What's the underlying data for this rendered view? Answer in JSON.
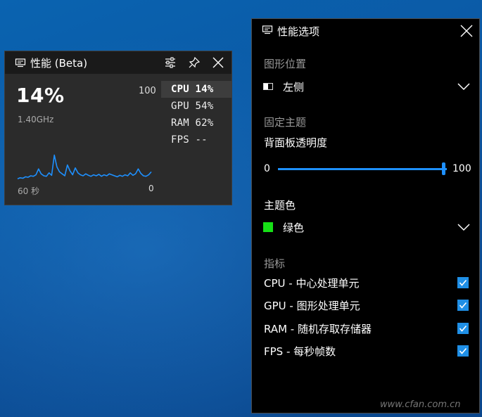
{
  "colors": {
    "accent": "#1e90ff",
    "chart_line": "#1e90ff",
    "theme_swatch": "#16e016"
  },
  "perf_widget": {
    "title": "性能 (Beta)",
    "icons": [
      "monitor-icon",
      "settings-sliders-icon",
      "pin-icon",
      "close-icon"
    ],
    "big_value": "14%",
    "max_label": "100",
    "frequency": "1.40GHz",
    "axis_left": "60 秒",
    "axis_right": "0",
    "metrics": [
      {
        "label": "CPU  14%",
        "active": true
      },
      {
        "label": "GPU  54%",
        "active": false
      },
      {
        "label": "RAM  62%",
        "active": false
      },
      {
        "label": "FPS --",
        "active": false
      }
    ],
    "sparkline_values": [
      4,
      6,
      5,
      8,
      7,
      10,
      9,
      12,
      24,
      14,
      10,
      9,
      16,
      11,
      52,
      28,
      18,
      14,
      10,
      32,
      20,
      12,
      26,
      16,
      12,
      10,
      14,
      11,
      9,
      12,
      10,
      13,
      9,
      12,
      10,
      14,
      12,
      10,
      8,
      11,
      9,
      12,
      10,
      16,
      11,
      14,
      24,
      15,
      10,
      9,
      12,
      18
    ]
  },
  "options_panel": {
    "title": "性能选项",
    "position_section": "图形位置",
    "position_value": "左侧",
    "pin_section": "固定主题",
    "opacity_label": "背面板透明度",
    "opacity_min": "0",
    "opacity_max": "100",
    "opacity_value": 100,
    "theme_color_label": "主题色",
    "theme_color_value": "绿色",
    "metrics_section": "指标",
    "checks": [
      {
        "label": "CPU - 中心处理单元",
        "checked": true
      },
      {
        "label": "GPU - 图形处理单元",
        "checked": true
      },
      {
        "label": "RAM - 随机存取存储器",
        "checked": true
      },
      {
        "label": "FPS - 每秒帧数",
        "checked": true
      }
    ]
  },
  "watermark": "www.cfan.com.cn"
}
